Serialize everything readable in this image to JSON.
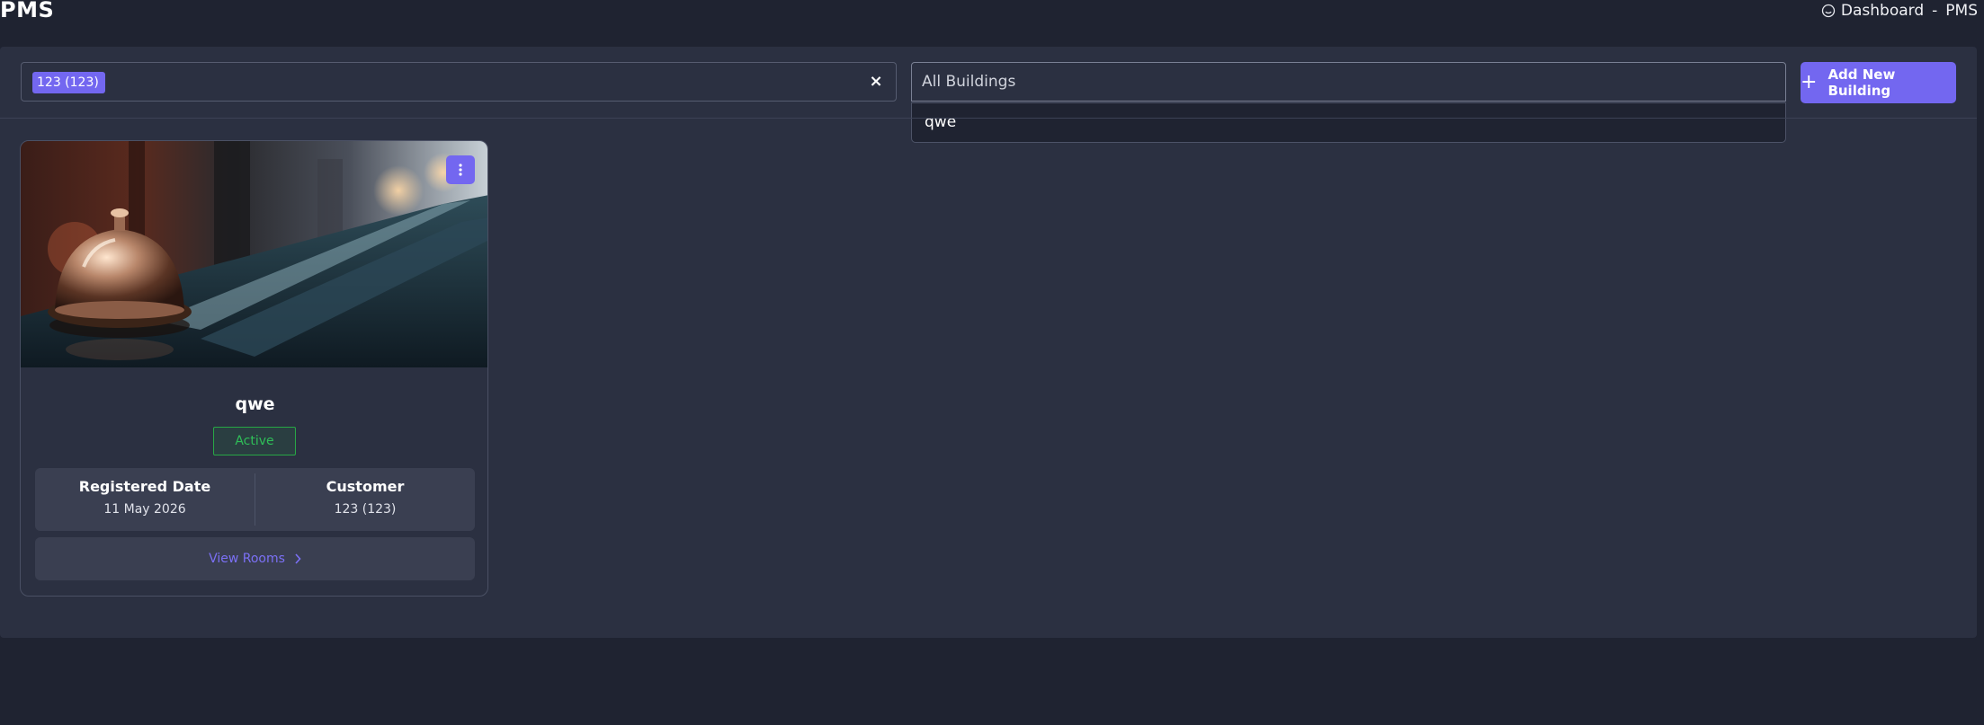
{
  "header": {
    "app_title": "PMS",
    "breadcrumb": {
      "home_label": "Dashboard",
      "separator": "-",
      "current": "PMS"
    }
  },
  "filters": {
    "customer_chip": "123 (123)",
    "building_search_placeholder": "All Buildings",
    "dropdown_option": "qwe"
  },
  "toolbar": {
    "add_building_label": "Add New Building"
  },
  "building_card": {
    "name": "qwe",
    "status": "Active",
    "registered_label": "Registered Date",
    "registered_value": "11 May 2026",
    "customer_label": "Customer",
    "customer_value": "123 (123)",
    "view_rooms_label": "View Rooms"
  },
  "colors": {
    "accent": "#7367f0",
    "status_active": "#28a745",
    "background": "#1f2331",
    "panel": "#2b3041"
  },
  "icons": [
    "home-icon",
    "close-icon",
    "plus-icon",
    "more-vertical-icon",
    "chevron-right-icon"
  ]
}
